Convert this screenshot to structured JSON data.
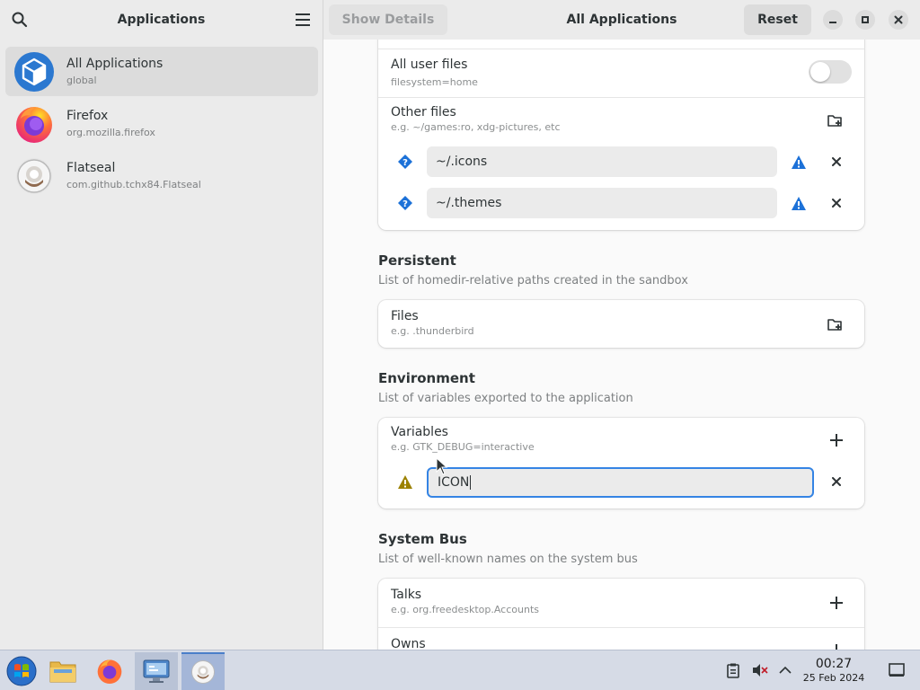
{
  "sidebar": {
    "title": "Applications",
    "apps": [
      {
        "name": "All Applications",
        "id": "global"
      },
      {
        "name": "Firefox",
        "id": "org.mozilla.firefox"
      },
      {
        "name": "Flatseal",
        "id": "com.github.tchx84.Flatseal"
      }
    ]
  },
  "header": {
    "show_details_label": "Show Details",
    "title": "All Applications",
    "reset_label": "Reset"
  },
  "filesystem": {
    "all_user_files": {
      "title": "All user files",
      "subtitle": "filesystem=home",
      "enabled": false
    },
    "other_files": {
      "title": "Other files",
      "subtitle": "e.g. ~/games:ro, xdg-pictures, etc",
      "entries": [
        "~/.icons",
        "~/.themes"
      ]
    }
  },
  "persistent": {
    "title": "Persistent",
    "description": "List of homedir-relative paths created in the sandbox",
    "files": {
      "title": "Files",
      "subtitle": "e.g. .thunderbird"
    }
  },
  "environment": {
    "title": "Environment",
    "description": "List of variables exported to the application",
    "variables": {
      "title": "Variables",
      "subtitle": "e.g. GTK_DEBUG=interactive",
      "entry_value": "ICON"
    }
  },
  "system_bus": {
    "title": "System Bus",
    "description": "List of well-known names on the system bus",
    "talks": {
      "title": "Talks",
      "subtitle": "e.g. org.freedesktop.Accounts"
    },
    "owns": {
      "title": "Owns"
    }
  },
  "taskbar": {
    "time": "00:27",
    "date": "25 Feb 2024"
  },
  "colors": {
    "accent": "#3584e4",
    "warning": "#c09b00",
    "info": "#1c71d8"
  }
}
